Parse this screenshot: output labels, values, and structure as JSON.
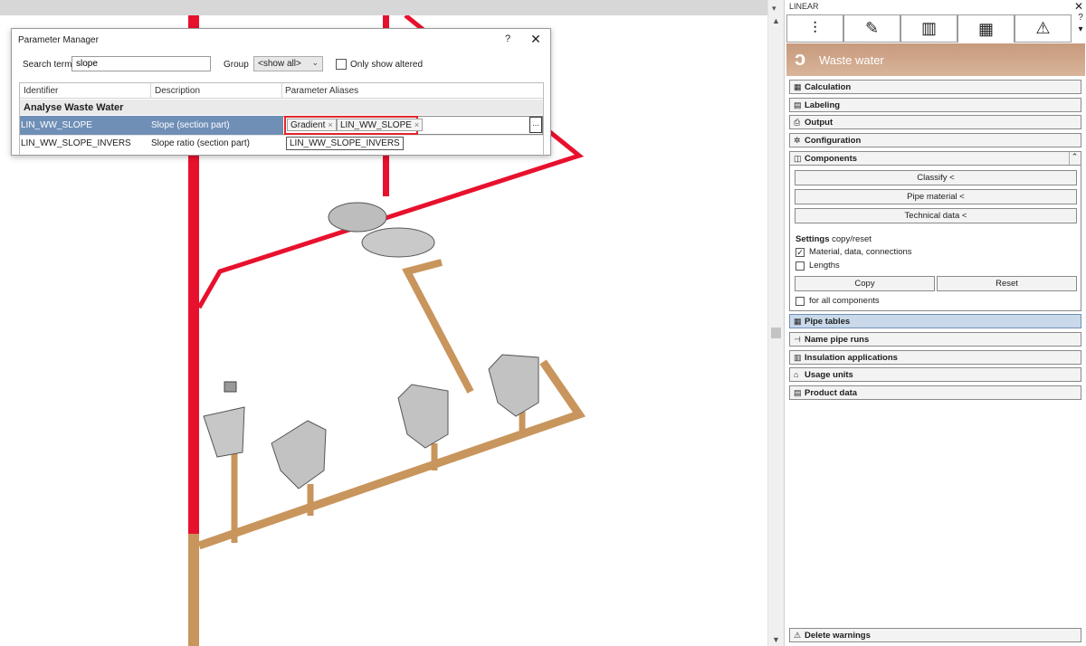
{
  "dialog": {
    "title": "Parameter Manager",
    "help": "?",
    "close": "✕",
    "search_label": "Search term",
    "search_value": "slope",
    "group_label": "Group",
    "group_value": "<show all>",
    "only_altered_label": "Only show altered",
    "columns": [
      "Identifier",
      "Description",
      "Parameter Aliases"
    ],
    "group_row": "Analyse Waste Water",
    "rows": [
      {
        "identifier": "LIN_WW_SLOPE",
        "description": "Slope (section part)",
        "aliases": [
          "Gradient",
          "LIN_WW_SLOPE"
        ]
      },
      {
        "identifier": "LIN_WW_SLOPE_INVERS",
        "description": "Slope ratio (section part)",
        "aliases": [
          "LIN_WW_SLOPE_INVERS"
        ]
      }
    ],
    "ellipsis": "...",
    "tag_remove": "×"
  },
  "panel": {
    "title": "LINEAR",
    "close": "✕",
    "help": "?",
    "banner_title": "Waste water",
    "tabs": [
      {
        "icon": "sliders-icon",
        "glyph": "⫶"
      },
      {
        "icon": "pencil-icon",
        "glyph": "✎"
      },
      {
        "icon": "library-icon",
        "glyph": "▥"
      },
      {
        "icon": "grid-icon",
        "glyph": "▦"
      },
      {
        "icon": "warning-icon",
        "glyph": "⚠"
      }
    ],
    "sections": {
      "calculation": "Calculation",
      "labeling": "Labeling",
      "output": "Output",
      "configuration": "Configuration",
      "components": "Components",
      "pipe_tables": "Pipe tables",
      "name_pipe_runs": "Name pipe runs",
      "insulation": "Insulation applications",
      "usage_units": "Usage units",
      "product_data": "Product data"
    },
    "components": {
      "classify": "Classify  <",
      "pipe_material": "Pipe material  <",
      "technical_data": "Technical data  <",
      "settings_bold": "Settings",
      "settings_rest": " copy/reset",
      "opt_material": "Material, data, connections",
      "opt_lengths": "Lengths",
      "copy": "Copy",
      "reset": "Reset",
      "all_components": "for all components"
    },
    "delete_warnings": "Delete warnings"
  },
  "colors": {
    "accent_selection": "#6f8fb7",
    "highlight_red": "#e0262c",
    "pipe_red": "#e8112d",
    "pipe_brown": "#c8955c",
    "banner": "#c79a7c"
  }
}
